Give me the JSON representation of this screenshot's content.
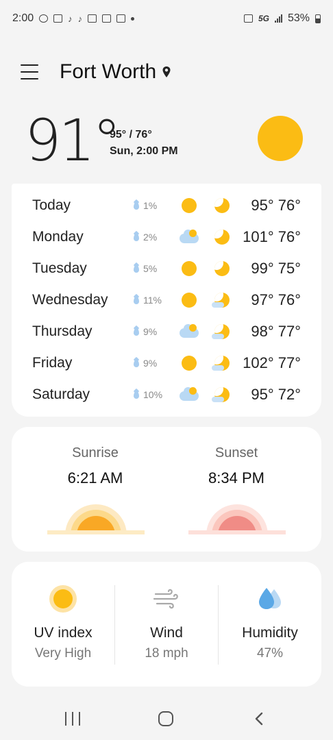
{
  "status_bar": {
    "time": "2:00",
    "network": "5G",
    "battery": "53%"
  },
  "header": {
    "city": "Fort Worth"
  },
  "current": {
    "temp": "91°",
    "hi_lo": "95° / 76°",
    "datetime": "Sun, 2:00 PM",
    "condition_icon": "sun-icon"
  },
  "forecast": [
    {
      "day": "Today",
      "precip": "1%",
      "day_icon": "sunny",
      "night_icon": "moon",
      "temps": "95° 76°"
    },
    {
      "day": "Monday",
      "precip": "2%",
      "day_icon": "partly-cloudy",
      "night_icon": "moon",
      "temps": "101° 76°"
    },
    {
      "day": "Tuesday",
      "precip": "5%",
      "day_icon": "sunny",
      "night_icon": "moon",
      "temps": "99° 75°"
    },
    {
      "day": "Wednesday",
      "precip": "11%",
      "day_icon": "sunny",
      "night_icon": "moon-cloud",
      "temps": "97° 76°"
    },
    {
      "day": "Thursday",
      "precip": "9%",
      "day_icon": "partly-cloudy",
      "night_icon": "moon-cloud",
      "temps": "98° 77°"
    },
    {
      "day": "Friday",
      "precip": "9%",
      "day_icon": "sunny",
      "night_icon": "moon-cloud",
      "temps": "102° 77°"
    },
    {
      "day": "Saturday",
      "precip": "10%",
      "day_icon": "partly-cloudy",
      "night_icon": "moon-cloud",
      "temps": "95° 72°"
    }
  ],
  "sun": {
    "sunrise_label": "Sunrise",
    "sunrise_time": "6:21 AM",
    "sunset_label": "Sunset",
    "sunset_time": "8:34 PM"
  },
  "details": {
    "uv_label": "UV index",
    "uv_value": "Very High",
    "wind_label": "Wind",
    "wind_value": "18 mph",
    "humidity_label": "Humidity",
    "humidity_value": "47%"
  },
  "colors": {
    "sun": "#fbbc14",
    "cloud": "#b9d9f4",
    "sunset": "#f28b82",
    "background": "#f4f4f4"
  }
}
